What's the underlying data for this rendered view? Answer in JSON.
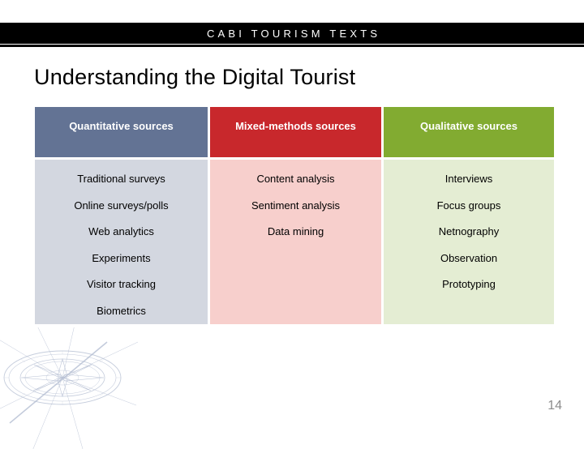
{
  "banner": {
    "text": "CABI TOURISM TEXTS"
  },
  "slide": {
    "title": "Understanding the Digital Tourist",
    "page_number": "14"
  },
  "colors": {
    "header_quantitative": "#637394",
    "header_mixed": "#c8282c",
    "header_qualitative": "#82ab31",
    "body_quantitative": "#d3d7e0",
    "body_mixed": "#f7cfcc",
    "body_qualitative": "#e4edd3",
    "banner_background": "#000000",
    "banner_text": "#ffffff",
    "page_number": "#8c8c8c",
    "compass_stroke": "#7b8cb0"
  },
  "table": {
    "headers": [
      "Quantitative sources",
      "Mixed-methods sources",
      "Qualitative sources"
    ],
    "columns": [
      {
        "header": "Quantitative sources",
        "items": [
          "Traditional surveys",
          "Online surveys/polls",
          "Web analytics",
          "Experiments",
          "Visitor tracking",
          "Biometrics"
        ]
      },
      {
        "header": "Mixed-methods sources",
        "items": [
          "Content analysis",
          "Sentiment analysis",
          "Data mining",
          "",
          "",
          ""
        ]
      },
      {
        "header": "Qualitative sources",
        "items": [
          "Interviews",
          "Focus groups",
          "Netnography",
          "Observation",
          "Prototyping",
          ""
        ]
      }
    ]
  }
}
